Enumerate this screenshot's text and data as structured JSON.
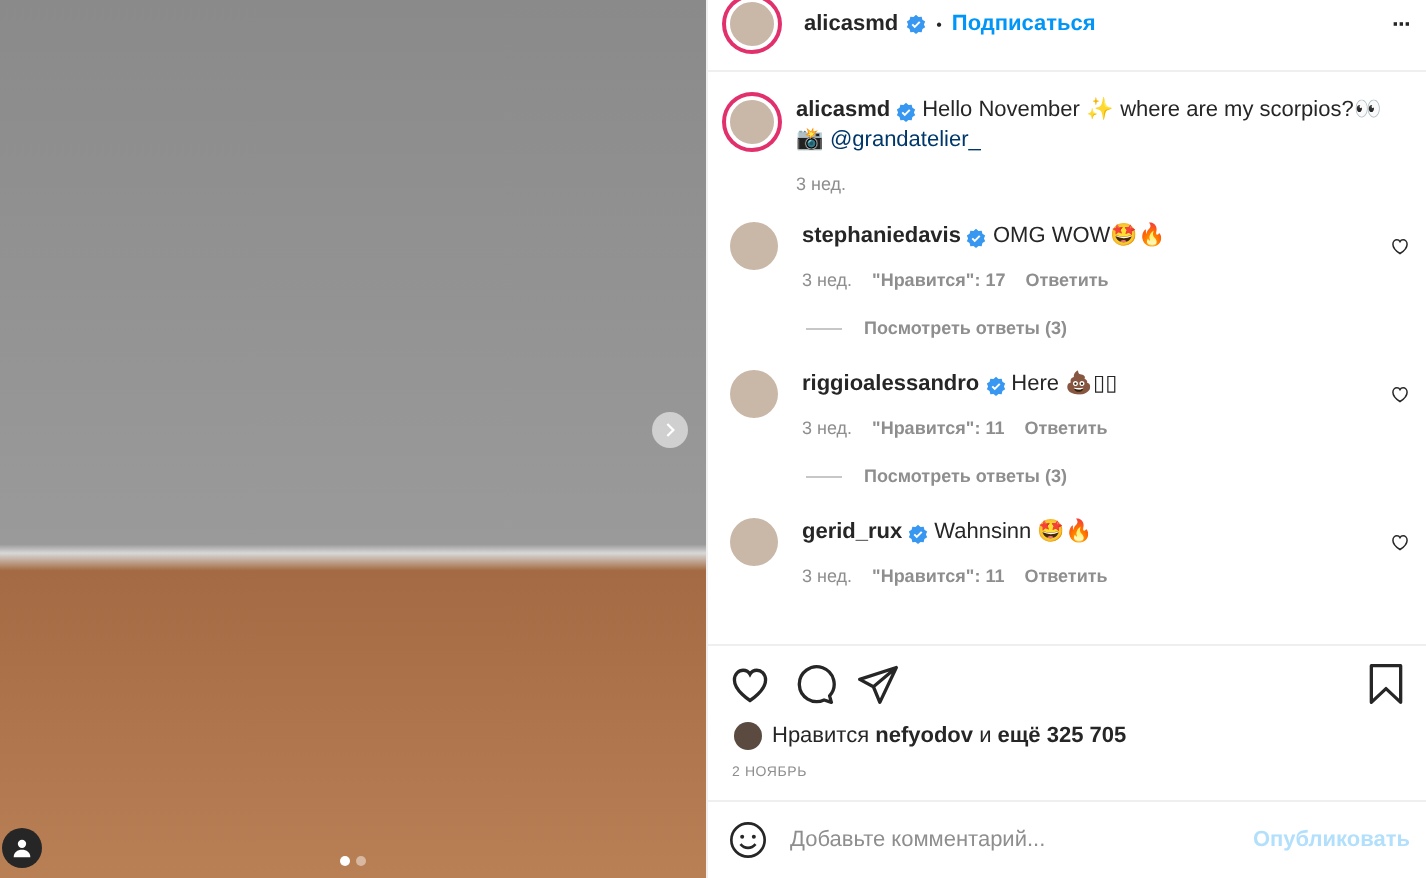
{
  "photo": {
    "slides": [
      {
        "selected": true
      },
      {
        "selected": false
      }
    ]
  },
  "header": {
    "author": "alicasmd",
    "verified": true,
    "separator": "•",
    "follow_label": "Подписаться",
    "more": "···"
  },
  "caption": {
    "author": "alicasmd",
    "verified": true,
    "text": "Hello November ✨ where are my scorpios?👀",
    "camera": "📸",
    "mention": "@grandatelier_",
    "time": "3 нед."
  },
  "comments": [
    {
      "author": "stephaniedavis",
      "verified": true,
      "text": "OMG WOW🤩🔥",
      "time": "3 нед.",
      "likes": "\"Нравится\": 17",
      "reply": "Ответить",
      "view_replies": "Посмотреть ответы (3)"
    },
    {
      "author": "riggioalessandro",
      "verified": true,
      "text": "Here 💩▯▯",
      "time": "3 нед.",
      "likes": "\"Нравится\": 11",
      "reply": "Ответить",
      "view_replies": "Посмотреть ответы (3)"
    },
    {
      "author": "gerid_rux",
      "verified": true,
      "text": "Wahnsinn 🤩🔥",
      "time": "3 нед.",
      "likes": "\"Нравится\": 11",
      "reply": "Ответить"
    }
  ],
  "likes_text": "Нравится **nefyodov** и **ещё 325 705**",
  "date": "2 НОЯБРЬ",
  "comment_field": {
    "placeholder": "Добавьте комментарий..."
  },
  "publish": {
    "label": "Опубликовать",
    "disabled": true
  }
}
